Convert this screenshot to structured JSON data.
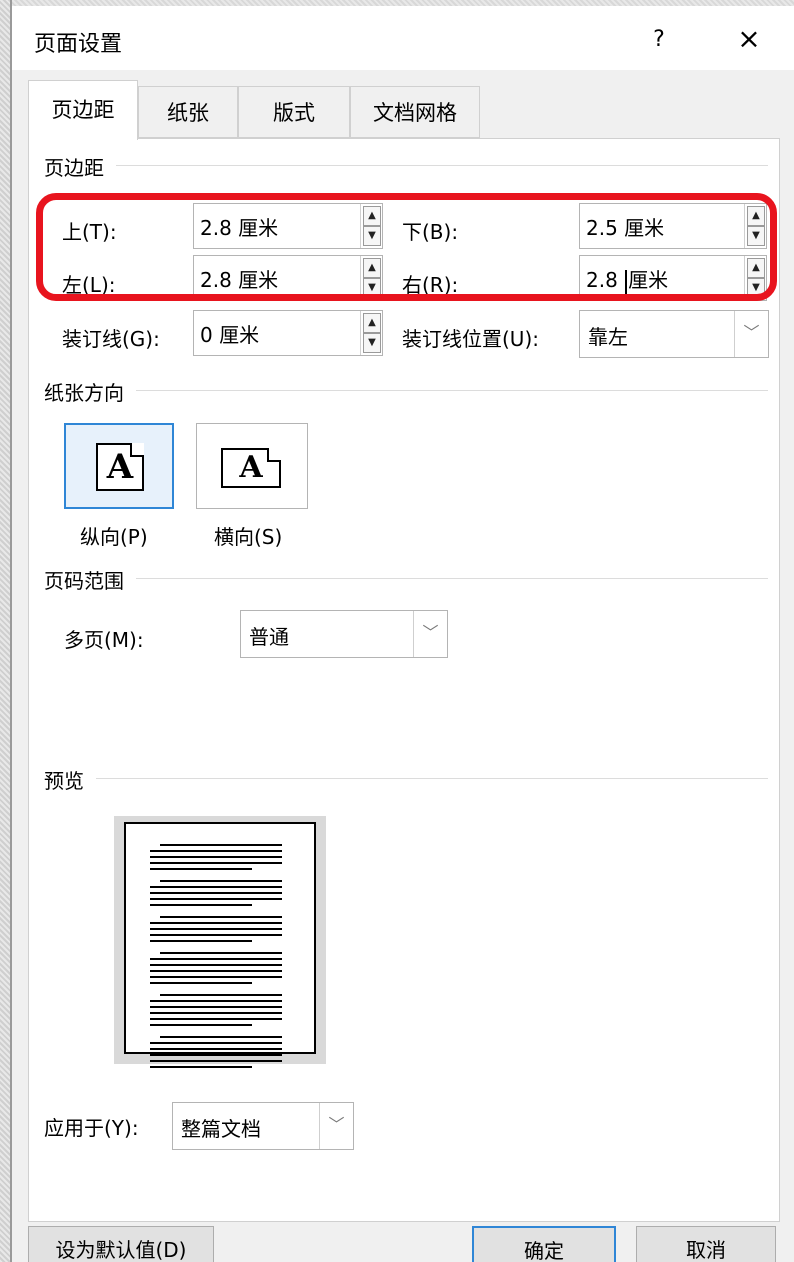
{
  "window": {
    "title": "页面设置",
    "help": "?",
    "close": "×"
  },
  "tabs": [
    {
      "label": "页边距",
      "active": true
    },
    {
      "label": "纸张"
    },
    {
      "label": "版式"
    },
    {
      "label": "文档网格"
    }
  ],
  "margins": {
    "group_label": "页边距",
    "top_label": "上(T):",
    "top_value": "2.8 厘米",
    "bottom_label": "下(B):",
    "bottom_value": "2.5 厘米",
    "left_label": "左(L):",
    "left_value": "2.8 厘米",
    "right_label": "右(R):",
    "right_value_number": "2.8",
    "right_value_unit": "厘米",
    "gutter_label": "装订线(G):",
    "gutter_value": "0 厘米",
    "gutter_pos_label": "装订线位置(U):",
    "gutter_pos_value": "靠左"
  },
  "orientation": {
    "group_label": "纸张方向",
    "portrait_label": "纵向(P)",
    "landscape_label": "横向(S)",
    "icon_letter": "A",
    "selected": "portrait"
  },
  "pages": {
    "group_label": "页码范围",
    "multiple_label": "多页(M):",
    "multiple_value": "普通"
  },
  "preview": {
    "group_label": "预览"
  },
  "apply": {
    "label": "应用于(Y):",
    "value": "整篇文档"
  },
  "footer": {
    "default_button": "设为默认值(D)",
    "ok_button": "确定",
    "cancel_button": "取消"
  },
  "colors": {
    "highlight": "#e8141e",
    "focus": "#2f86d6"
  }
}
